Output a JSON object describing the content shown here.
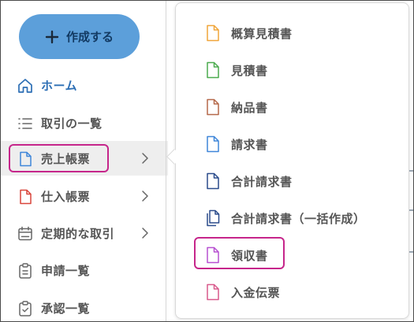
{
  "sidebar": {
    "create_button": "作成する",
    "items": [
      {
        "label": "ホーム",
        "icon": "home-icon"
      },
      {
        "label": "取引の一覧",
        "icon": "list-icon"
      },
      {
        "label": "売上帳票",
        "icon": "document-icon"
      },
      {
        "label": "仕入帳票",
        "icon": "document-icon"
      },
      {
        "label": "定期的な取引",
        "icon": "calendar-icon"
      },
      {
        "label": "申請一覧",
        "icon": "clipboard-icon"
      },
      {
        "label": "承認一覧",
        "icon": "clipboard-icon"
      }
    ]
  },
  "submenu": {
    "items": [
      {
        "label": "概算見積書",
        "color": "#f0a53a"
      },
      {
        "label": "見積書",
        "color": "#4bab4f"
      },
      {
        "label": "納品書",
        "color": "#b5694a"
      },
      {
        "label": "請求書",
        "color": "#3f86d9"
      },
      {
        "label": "合計請求書",
        "color": "#2b4c8c"
      },
      {
        "label": "合計請求書（一括作成）",
        "color": "#2b4c8c"
      },
      {
        "label": "領収書",
        "color": "#b750d1"
      },
      {
        "label": "入金伝票",
        "color": "#d95a8c"
      }
    ]
  },
  "colors": {
    "accent": "#5c9fda",
    "highlight": "#c6268b",
    "active_bg": "#eeeeee"
  }
}
